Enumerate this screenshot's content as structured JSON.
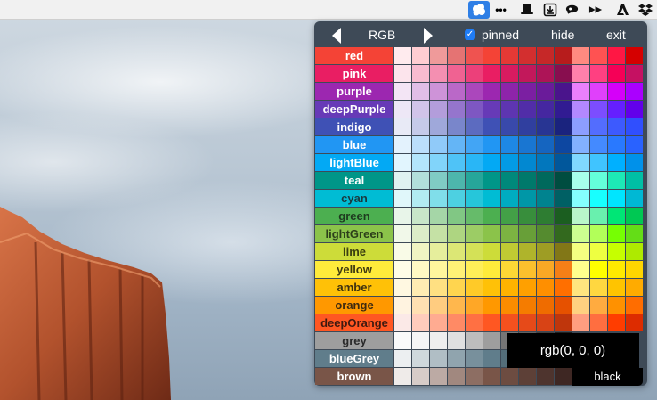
{
  "menubar": {
    "icons": [
      "palette-app-icon",
      "more-dots-icon",
      "top-hat-icon",
      "download-box-icon",
      "cloud-eye-icon",
      "arrows-icon",
      "adobe-icon",
      "dropbox-icon"
    ],
    "more_label": "•••"
  },
  "palette": {
    "mode_label": "RGB",
    "pinned_label": "pinned",
    "pinned_checked": true,
    "hide_label": "hide",
    "exit_label": "exit",
    "rgb_readout": "rgb(0, 0, 0)",
    "black_label": "black",
    "rows": [
      {
        "name": "red",
        "color": "#f44336",
        "text": "#ffffff",
        "shades": [
          "#ffebee",
          "#ffcdd2",
          "#ef9a9a",
          "#e57373",
          "#ef5350",
          "#f44336",
          "#e53935",
          "#d32f2f",
          "#c62828",
          "#b71c1c",
          "#ff8a80",
          "#ff5252",
          "#ff1744",
          "#d50000"
        ]
      },
      {
        "name": "pink",
        "color": "#e91e63",
        "text": "#ffffff",
        "shades": [
          "#fce4ec",
          "#f8bbd0",
          "#f48fb1",
          "#f06292",
          "#ec407a",
          "#e91e63",
          "#d81b60",
          "#c2185b",
          "#ad1457",
          "#880e4f",
          "#ff80ab",
          "#ff4081",
          "#f50057",
          "#c51162"
        ]
      },
      {
        "name": "purple",
        "color": "#9c27b0",
        "text": "#ffffff",
        "shades": [
          "#f3e5f5",
          "#e1bee7",
          "#ce93d8",
          "#ba68c8",
          "#ab47bc",
          "#9c27b0",
          "#8e24aa",
          "#7b1fa2",
          "#6a1b9a",
          "#4a148c",
          "#ea80fc",
          "#e040fb",
          "#d500f9",
          "#aa00ff"
        ]
      },
      {
        "name": "deepPurple",
        "color": "#673ab7",
        "text": "#ffffff",
        "shades": [
          "#ede7f6",
          "#d1c4e9",
          "#b39ddb",
          "#9575cd",
          "#7e57c2",
          "#673ab7",
          "#5e35b1",
          "#512da8",
          "#4527a0",
          "#311b92",
          "#b388ff",
          "#7c4dff",
          "#651fff",
          "#6200ea"
        ]
      },
      {
        "name": "indigo",
        "color": "#3f51b5",
        "text": "#ffffff",
        "shades": [
          "#e8eaf6",
          "#c5cae9",
          "#9fa8da",
          "#7986cb",
          "#5c6bc0",
          "#3f51b5",
          "#3949ab",
          "#303f9f",
          "#283593",
          "#1a237e",
          "#8c9eff",
          "#536dfe",
          "#3d5afe",
          "#304ffe"
        ]
      },
      {
        "name": "blue",
        "color": "#2196f3",
        "text": "#ffffff",
        "shades": [
          "#e3f2fd",
          "#bbdefb",
          "#90caf9",
          "#64b5f6",
          "#42a5f5",
          "#2196f3",
          "#1e88e5",
          "#1976d2",
          "#1565c0",
          "#0d47a1",
          "#82b1ff",
          "#448aff",
          "#2979ff",
          "#2962ff"
        ]
      },
      {
        "name": "lightBlue",
        "color": "#03a9f4",
        "text": "#ffffff",
        "shades": [
          "#e1f5fe",
          "#b3e5fc",
          "#81d4fa",
          "#4fc3f7",
          "#29b6f6",
          "#03a9f4",
          "#039be5",
          "#0288d1",
          "#0277bd",
          "#01579b",
          "#80d8ff",
          "#40c4ff",
          "#00b0ff",
          "#0091ea"
        ]
      },
      {
        "name": "teal",
        "color": "#009688",
        "text": "#ffffff",
        "shades": [
          "#e0f2f1",
          "#b2dfdb",
          "#80cbc4",
          "#4db6ac",
          "#26a69a",
          "#009688",
          "#00897b",
          "#00796b",
          "#00695c",
          "#004d40",
          "#a7ffeb",
          "#64ffda",
          "#1de9b6",
          "#00bfa5"
        ]
      },
      {
        "name": "cyan",
        "color": "#00bcd4",
        "text": "#1a3a40",
        "shades": [
          "#e0f7fa",
          "#b2ebf2",
          "#80deea",
          "#4dd0e1",
          "#26c6da",
          "#00bcd4",
          "#00acc1",
          "#0097a7",
          "#00838f",
          "#006064",
          "#84ffff",
          "#18ffff",
          "#00e5ff",
          "#00b8d4"
        ]
      },
      {
        "name": "green",
        "color": "#4caf50",
        "text": "#1e3a1f",
        "shades": [
          "#e8f5e9",
          "#c8e6c9",
          "#a5d6a7",
          "#81c784",
          "#66bb6a",
          "#4caf50",
          "#43a047",
          "#388e3c",
          "#2e7d32",
          "#1b5e20",
          "#b9f6ca",
          "#69f0ae",
          "#00e676",
          "#00c853"
        ]
      },
      {
        "name": "lightGreen",
        "color": "#8bc34a",
        "text": "#2c3e1a",
        "shades": [
          "#f1f8e9",
          "#dcedc8",
          "#c5e1a5",
          "#aed581",
          "#9ccc65",
          "#8bc34a",
          "#7cb342",
          "#689f38",
          "#558b2f",
          "#33691e",
          "#ccff90",
          "#b2ff59",
          "#76ff03",
          "#64dd17"
        ]
      },
      {
        "name": "lime",
        "color": "#cddc39",
        "text": "#3a3f10",
        "shades": [
          "#f9fbe7",
          "#f0f4c3",
          "#e6ee9c",
          "#dce775",
          "#d4e157",
          "#cddc39",
          "#c0ca33",
          "#afb42b",
          "#9e9d24",
          "#827717",
          "#f4ff81",
          "#eeff41",
          "#c6ff00",
          "#aeea00"
        ]
      },
      {
        "name": "yellow",
        "color": "#ffeb3b",
        "text": "#3f3a10",
        "shades": [
          "#fffde7",
          "#fff9c4",
          "#fff59d",
          "#fff176",
          "#ffee58",
          "#ffeb3b",
          "#fdd835",
          "#fbc02d",
          "#f9a825",
          "#f57f17",
          "#ffff8d",
          "#ffff00",
          "#ffea00",
          "#ffd600"
        ]
      },
      {
        "name": "amber",
        "color": "#ffc107",
        "text": "#3f3210",
        "shades": [
          "#fff8e1",
          "#ffecb3",
          "#ffe082",
          "#ffd54f",
          "#ffca28",
          "#ffc107",
          "#ffb300",
          "#ffa000",
          "#ff8f00",
          "#ff6f00",
          "#ffe57f",
          "#ffd740",
          "#ffc400",
          "#ffab00"
        ]
      },
      {
        "name": "orange",
        "color": "#ff9800",
        "text": "#3f2a10",
        "shades": [
          "#fff3e0",
          "#ffe0b2",
          "#ffcc80",
          "#ffb74d",
          "#ffa726",
          "#ff9800",
          "#fb8c00",
          "#f57c00",
          "#ef6c00",
          "#e65100",
          "#ffd180",
          "#ffab40",
          "#ff9100",
          "#ff6d00"
        ]
      },
      {
        "name": "deepOrange",
        "color": "#ff5722",
        "text": "#3f1a10",
        "shades": [
          "#fbe9e7",
          "#ffccbc",
          "#ffab91",
          "#ff8a65",
          "#ff7043",
          "#ff5722",
          "#f4511e",
          "#e64a19",
          "#d84315",
          "#bf360c",
          "#ff9e80",
          "#ff6e40",
          "#ff3d00",
          "#dd2c00"
        ]
      },
      {
        "name": "grey",
        "color": "#9e9e9e",
        "text": "#2a2a2a",
        "shades": [
          "#fafafa",
          "#f5f5f5",
          "#eeeeee",
          "#e0e0e0",
          "#bdbdbd",
          "#9e9e9e",
          "#757575",
          "#616161",
          "#424242",
          "#212121"
        ]
      },
      {
        "name": "blueGrey",
        "color": "#607d8b",
        "text": "#ffffff",
        "shades": [
          "#eceff1",
          "#cfd8dc",
          "#b0bec5",
          "#90a4ae",
          "#78909c",
          "#607d8b",
          "#546e7a",
          "#455a64",
          "#37474f",
          "#263238"
        ]
      },
      {
        "name": "brown",
        "color": "#795548",
        "text": "#ffffff",
        "shades": [
          "#efebe9",
          "#d7ccc8",
          "#bcaaa4",
          "#a1887f",
          "#8d6e63",
          "#795548",
          "#6d4c41",
          "#5d4037",
          "#4e342e",
          "#3e2723"
        ]
      }
    ]
  }
}
